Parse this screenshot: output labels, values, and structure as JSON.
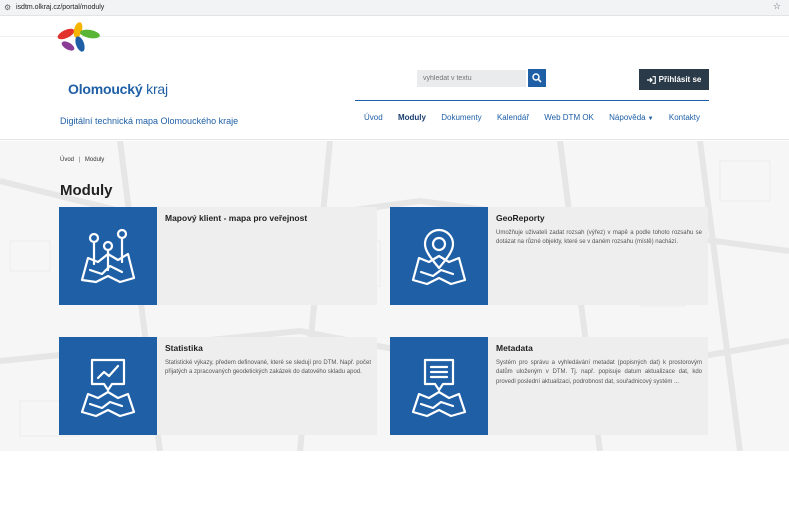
{
  "browser": {
    "url": "isdtm.olkraj.cz/portal/moduly",
    "site_icon": "site-settings-icon",
    "bookmark_icon": "star-icon"
  },
  "header": {
    "logo_name": "Olomoucký",
    "logo_suffix": "kraj",
    "subtitle": "Digitální technická mapa Olomouckého kraje",
    "search_placeholder": "vyhledat v textu",
    "login_label": "Přihlásit se"
  },
  "nav": {
    "items": [
      {
        "label": "Úvod"
      },
      {
        "label": "Moduly",
        "active": true
      },
      {
        "label": "Dokumenty"
      },
      {
        "label": "Kalendář"
      },
      {
        "label": "Web DTM OK"
      },
      {
        "label": "Nápověda",
        "dropdown": true
      },
      {
        "label": "Kontakty"
      }
    ]
  },
  "breadcrumb": {
    "home": "Úvod",
    "separator": "|",
    "current": "Moduly"
  },
  "page": {
    "title": "Moduly"
  },
  "cards": [
    {
      "title": "Mapový klient - mapa pro veřejnost",
      "description": "",
      "icon": "map-pins-icon"
    },
    {
      "title": "GeoReporty",
      "description": "Umožňuje uživateli zadat rozsah (výřez) v mapě a podle tohoto rozsahu se dotázat na různé objekty, které se v daném rozsahu (místě) nachází.",
      "icon": "map-location-icon"
    },
    {
      "title": "Statistika",
      "description": "Statistické výkazy, předem definované, které se sledují pro DTM. Např. počet přijatých a zpracovaných geodetických zakázek do datového skladu apod.",
      "icon": "map-chart-icon"
    },
    {
      "title": "Metadata",
      "description": "Systém pro správu a vyhledávání metadat (popisných dat) k prostorovým datům uloženým v DTM. Tj. např. popisuje datum aktualizace dat, kdo provedl poslední aktualizaci, podrobnost dat, souřadnicový systém ...",
      "icon": "map-document-icon"
    }
  ],
  "colors": {
    "brand_blue": "#1f5fa6",
    "login_dark": "#2b3a48",
    "card_bg": "#eeeeee"
  }
}
